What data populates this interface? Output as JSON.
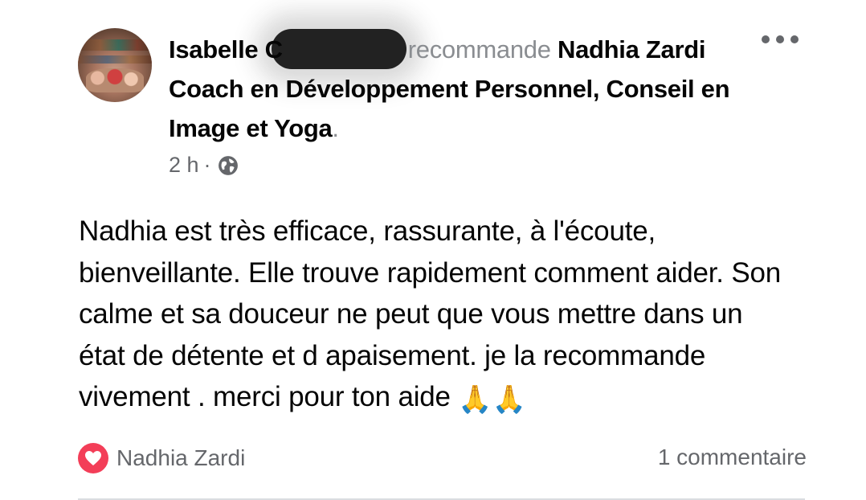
{
  "post": {
    "author_name_visible": "Isabelle C",
    "verb": "recommande",
    "page_name": "Nadhia Zardi Coach en Développement Personnel, Conseil en Image et Yoga",
    "period": ".",
    "timestamp": "2 h",
    "separator": "·",
    "privacy_icon": "globe-icon",
    "more_icon": "more-options-icon",
    "text_lines": [
      "Nadhia est très efficace, rassurante, à l'écoute,",
      "bienveillante. Elle trouve rapidement comment aider. Son",
      "calme et sa douceur ne peut que vous mettre dans un",
      "état de détente et d apaisement. je la recommande",
      "vivement . merci pour ton aide"
    ],
    "emoji": "🙏🙏"
  },
  "footer": {
    "reaction_icon": "heart-reaction-icon",
    "reaction_color": "#f33e58",
    "reactor_name": "Nadhia Zardi",
    "comments_label": "1 commentaire"
  },
  "colors": {
    "primary_text": "#050505",
    "secondary_text": "#65676b",
    "muted_text": "#8a8d91",
    "divider": "#dadde1"
  }
}
